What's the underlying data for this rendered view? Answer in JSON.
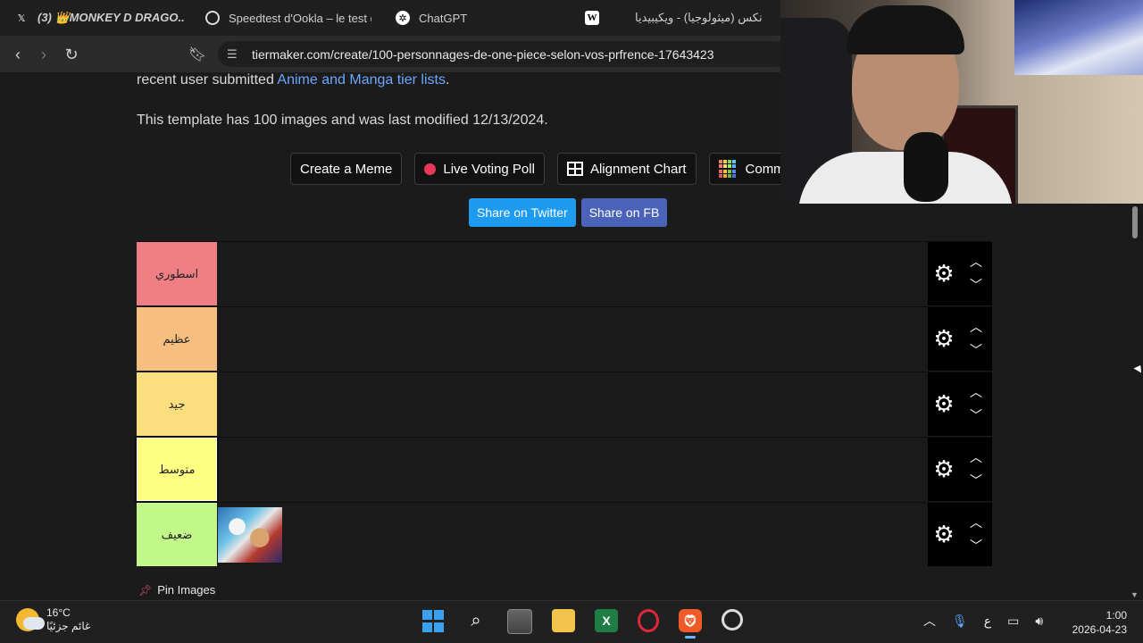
{
  "tabs": [
    {
      "label": "(3) 👑MONKEY D DRAGO...",
      "icon": "x-logo-icon"
    },
    {
      "label": "Speedtest d'Ookla – le test de ...",
      "icon": "speedtest-icon"
    },
    {
      "label": "ChatGPT",
      "icon": "chatgpt-icon"
    },
    {
      "label": "نكس (ميثولوجيا) - ويكيبيديا",
      "icon": "wikipedia-icon"
    }
  ],
  "url": "tiermaker.com/create/100-personnages-de-one-piece-selon-vos-prfrence-17643423",
  "page": {
    "intro_prefix": "recent user submitted ",
    "intro_link": "Anime and Manga tier lists",
    "intro_suffix": ".",
    "template_info": "This template has 100 images and was last modified 12/13/2024.",
    "buttons": [
      "Create a Meme",
      "Live Voting Poll",
      "Alignment Chart",
      "Community"
    ],
    "share": [
      "Share on Twitter",
      "Share on FB"
    ],
    "pin_label": "Pin Images"
  },
  "tiers": [
    {
      "label": "اسطوري",
      "color": "#f07f85"
    },
    {
      "label": "عظيم",
      "color": "#f6bf80"
    },
    {
      "label": "جيد",
      "color": "#fbdf7e"
    },
    {
      "label": "متوسط",
      "color": "#fdfe82"
    },
    {
      "label": "ضعيف",
      "color": "#c2f78a"
    }
  ],
  "taskbar": {
    "temperature": "16°C",
    "weather": "غائم جزئيًا",
    "lang": "ع",
    "time": "1:00",
    "date": "2026-04-23"
  }
}
